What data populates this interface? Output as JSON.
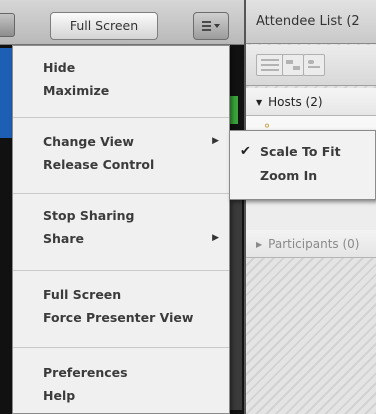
{
  "share_pod": {
    "fullscreen_label": "Full Screen",
    "menu_icon": "pod-menu-icon"
  },
  "attendee_pod": {
    "title": "Attendee List  (2",
    "hosts_label": "Hosts (2)",
    "participants_label": "Participants (0)"
  },
  "pod_menu": {
    "items": [
      {
        "label": "Hide"
      },
      {
        "label": "Maximize"
      },
      {
        "label": "Change View",
        "submenu": true
      },
      {
        "label": "Release Control"
      },
      {
        "label": "Stop Sharing"
      },
      {
        "label": "Share",
        "submenu": true
      },
      {
        "label": "Full Screen"
      },
      {
        "label": "Force Presenter View"
      },
      {
        "label": "Preferences"
      },
      {
        "label": "Help"
      }
    ]
  },
  "submenu": {
    "items": [
      {
        "label": "Scale To Fit",
        "checked": true
      },
      {
        "label": "Zoom In",
        "checked": false
      }
    ]
  },
  "colors": {
    "toolbar": "#c9c9c9",
    "menu_bg": "#f0f0f0",
    "menu_text": "#3b3b3b"
  }
}
